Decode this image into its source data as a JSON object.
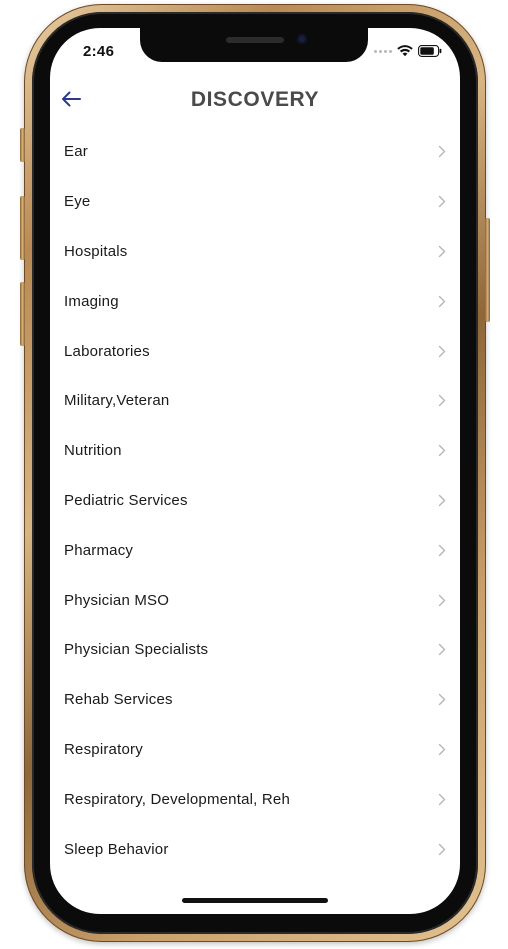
{
  "status_bar": {
    "time": "2:46"
  },
  "header": {
    "title": "DISCOVERY"
  },
  "colors": {
    "accent": "#2b3a8f",
    "title": "#4a4a4a",
    "chevron": "#b5b5b5"
  },
  "list": {
    "items": [
      {
        "label": "Ear"
      },
      {
        "label": "Eye"
      },
      {
        "label": "Hospitals"
      },
      {
        "label": "Imaging"
      },
      {
        "label": "Laboratories"
      },
      {
        "label": "Military,Veteran"
      },
      {
        "label": "Nutrition"
      },
      {
        "label": "Pediatric Services"
      },
      {
        "label": "Pharmacy"
      },
      {
        "label": "Physician MSO"
      },
      {
        "label": "Physician Specialists"
      },
      {
        "label": "Rehab Services"
      },
      {
        "label": "Respiratory"
      },
      {
        "label": "Respiratory, Developmental, Reh"
      },
      {
        "label": "Sleep Behavior"
      }
    ]
  }
}
